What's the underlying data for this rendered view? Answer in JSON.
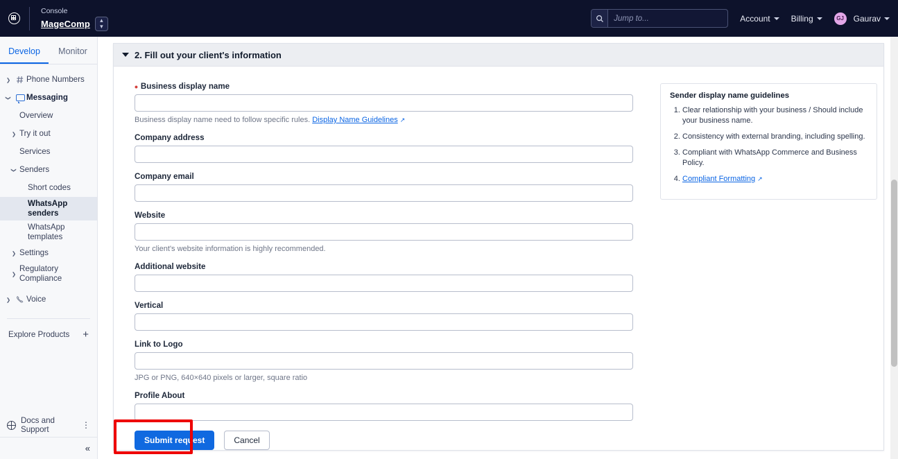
{
  "topbar": {
    "app_icon": "grid-circle-icon",
    "console_label": "Console",
    "account_name": "MageComp",
    "switcher_glyph": "⌃⌄",
    "search": {
      "icon": "search-icon",
      "placeholder": "Jump to...",
      "value": ""
    },
    "menus": [
      {
        "label": "Account",
        "icon": "chevron-down-icon"
      },
      {
        "label": "Billing",
        "icon": "chevron-down-icon"
      }
    ],
    "user": {
      "initials": "GJ",
      "name": "Gaurav",
      "icon": "chevron-down-icon"
    },
    "bg_color": "#0d122b"
  },
  "sidebar": {
    "tabs": [
      {
        "label": "Develop",
        "active": true
      },
      {
        "label": "Monitor",
        "active": false
      }
    ],
    "items": [
      {
        "label": "Phone Numbers",
        "icon": "hash-icon",
        "arrow": "right",
        "level": 0
      },
      {
        "label": "Messaging",
        "icon": "speech-bubble-icon",
        "arrow": "down",
        "level": 0,
        "bold": true
      },
      {
        "label": "Overview",
        "icon": "",
        "arrow": "",
        "level": 1
      },
      {
        "label": "Try it out",
        "icon": "",
        "arrow": "right",
        "level": 1
      },
      {
        "label": "Services",
        "icon": "",
        "arrow": "",
        "level": 1
      },
      {
        "label": "Senders",
        "icon": "",
        "arrow": "down",
        "level": 1
      },
      {
        "label": "Short codes",
        "icon": "",
        "arrow": "",
        "level": 2
      },
      {
        "label": "WhatsApp senders",
        "icon": "",
        "arrow": "",
        "level": 2,
        "selected": true
      },
      {
        "label": "WhatsApp templates",
        "icon": "",
        "arrow": "",
        "level": 2
      },
      {
        "label": "Settings",
        "icon": "",
        "arrow": "right",
        "level": 1
      },
      {
        "label": "Regulatory Compliance",
        "icon": "",
        "arrow": "right",
        "level": 1
      },
      {
        "label": "Voice",
        "icon": "phone-handset-icon",
        "arrow": "right",
        "level": 0
      }
    ],
    "explore_products": {
      "label": "Explore Products",
      "icon": "plus-icon"
    },
    "docs_support": {
      "label": "Docs and Support",
      "icon": "globe-icon",
      "menu_icon": "kebab-menu-icon"
    },
    "collapse": {
      "icon": "chevrons-left-icon",
      "glyph": "«"
    },
    "accent_color": "#0b65e4"
  },
  "main": {
    "section": {
      "title": "2. Fill out your client's information",
      "collapse_icon": "triangle-down-icon"
    },
    "fields": [
      {
        "label": "Business display name",
        "required": true,
        "value": "",
        "hint": "Business display name need to follow specific rules.",
        "hint_link": "Display Name Guidelines",
        "hint_link_icon": "external-link-icon"
      },
      {
        "label": "Company address",
        "required": false,
        "value": "",
        "hint": ""
      },
      {
        "label": "Company email",
        "required": false,
        "value": "",
        "hint": ""
      },
      {
        "label": "Website",
        "required": false,
        "value": "",
        "hint": "Your client's website information is highly recommended."
      },
      {
        "label": "Additional website",
        "required": false,
        "value": "",
        "hint": ""
      },
      {
        "label": "Vertical",
        "required": false,
        "value": "",
        "hint": ""
      },
      {
        "label": "Link to Logo",
        "required": false,
        "value": "",
        "hint": "JPG or PNG, 640×640 pixels or larger, square ratio"
      },
      {
        "label": "Profile About",
        "required": false,
        "value": "",
        "hint": ""
      }
    ],
    "actions": {
      "submit_label": "Submit request",
      "cancel_label": "Cancel",
      "highlight_color": "#ee0000",
      "submit_color": "#1069e0"
    },
    "guidelines": {
      "title": "Sender display name guidelines",
      "items": [
        "Clear relationship with your business / Should include your business name.",
        "Consistency with external branding, including spelling.",
        "Compliant with WhatsApp Commerce and Business Policy."
      ],
      "link_item": "Compliant Formatting",
      "link_icon": "external-link-icon"
    }
  }
}
